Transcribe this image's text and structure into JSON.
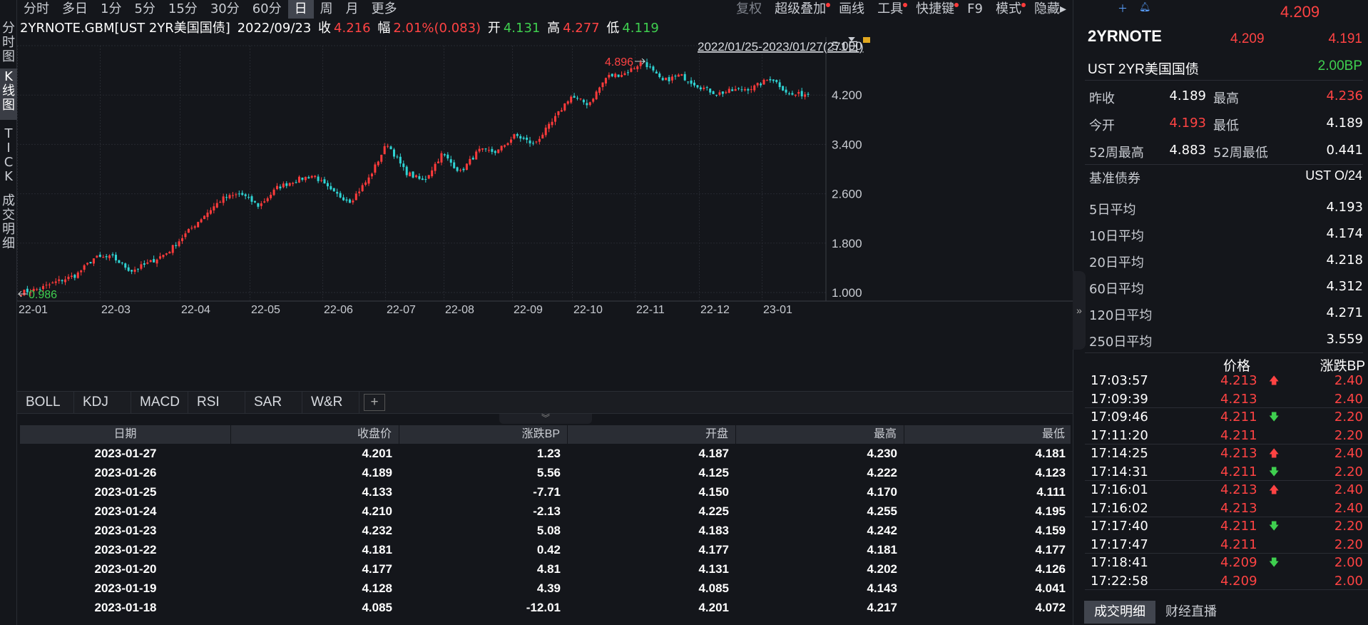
{
  "side_tabs": [
    {
      "label": "分时图",
      "active": false
    },
    {
      "label": "K线图",
      "active": true
    },
    {
      "label": "TICK",
      "active": false
    },
    {
      "label": "成交明细",
      "active": false
    }
  ],
  "toolbar": {
    "periods": [
      "分时",
      "多日",
      "1分",
      "5分",
      "15分",
      "30分",
      "60分",
      "日",
      "周",
      "月",
      "更多"
    ],
    "active_period": "日",
    "right_items": [
      {
        "label": "复权",
        "dim": true,
        "dot": false
      },
      {
        "label": "超级叠加",
        "dim": false,
        "dot": true
      },
      {
        "label": "画线",
        "dim": false,
        "dot": false
      },
      {
        "label": "工具",
        "dim": false,
        "dot": true
      },
      {
        "label": "快捷键",
        "dim": false,
        "dot": true
      },
      {
        "label": "F9",
        "dim": false,
        "dot": false
      },
      {
        "label": "模式",
        "dim": false,
        "dot": true
      },
      {
        "label": "隐藏▸",
        "dim": false,
        "dot": false
      }
    ]
  },
  "info": {
    "symbol": "2YRNOTE.GBM[UST 2YR美国国债]",
    "date": "2022/09/23",
    "close_label": "收",
    "close": "4.216",
    "change_label": "幅",
    "change": "2.01%(0.083)",
    "open_label": "开",
    "open": "4.131",
    "high_label": "高",
    "high": "4.277",
    "low_label": "低",
    "low": "4.119"
  },
  "chart_data": {
    "type": "candlestick",
    "range_label": "2022/01/25-2023/01/27(271日)",
    "ylim": [
      1.0,
      5.0
    ],
    "yticks": [
      "5.000",
      "4.200",
      "3.400",
      "2.600",
      "1.800",
      "1.000"
    ],
    "xticks": [
      "22-01",
      "22-03",
      "22-04",
      "22-05",
      "22-06",
      "22-07",
      "22-08",
      "22-09",
      "22-10",
      "22-11",
      "22-12",
      "23-01"
    ],
    "max_label": "4.896",
    "min_label": "0.986",
    "colors": {
      "up": "#ff3b3b",
      "down": "#2fd4d4",
      "grid": "#262930"
    },
    "closes": [
      1.0,
      1.06,
      1.18,
      1.28,
      1.56,
      1.57,
      1.35,
      1.48,
      1.65,
      1.95,
      2.25,
      2.52,
      2.6,
      2.4,
      2.7,
      2.82,
      2.9,
      2.62,
      2.48,
      2.85,
      3.42,
      2.95,
      2.8,
      3.25,
      2.95,
      3.3,
      3.28,
      3.55,
      3.4,
      3.75,
      4.18,
      4.05,
      4.5,
      4.55,
      4.75,
      4.42,
      4.52,
      4.35,
      4.22,
      4.28,
      4.32,
      4.48,
      4.2,
      4.22
    ]
  },
  "indicators": [
    "BOLL",
    "KDJ",
    "MACD",
    "RSI",
    "SAR",
    "W&R"
  ],
  "table": {
    "headers": [
      "日期",
      "收盘价",
      "涨跌BP",
      "开盘",
      "最高",
      "最低"
    ],
    "rows": [
      [
        "2023-01-27",
        "4.201",
        "1.23",
        "4.187",
        "4.230",
        "4.181"
      ],
      [
        "2023-01-26",
        "4.189",
        "5.56",
        "4.125",
        "4.222",
        "4.123"
      ],
      [
        "2023-01-25",
        "4.133",
        "-7.71",
        "4.150",
        "4.170",
        "4.111"
      ],
      [
        "2023-01-24",
        "4.210",
        "-2.13",
        "4.225",
        "4.255",
        "4.195"
      ],
      [
        "2023-01-23",
        "4.232",
        "5.08",
        "4.183",
        "4.242",
        "4.159"
      ],
      [
        "2023-01-22",
        "4.181",
        "0.42",
        "4.177",
        "4.181",
        "4.177"
      ],
      [
        "2023-01-20",
        "4.177",
        "4.81",
        "4.131",
        "4.202",
        "4.126"
      ],
      [
        "2023-01-19",
        "4.128",
        "4.39",
        "4.085",
        "4.143",
        "4.041"
      ],
      [
        "2023-01-18",
        "4.085",
        "-12.01",
        "4.201",
        "4.217",
        "4.072"
      ]
    ]
  },
  "quote": {
    "top_price": "4.209",
    "name": "2YRNOTE",
    "bid": "4.209",
    "ask": "4.191",
    "full_name": "UST 2YR美国国债",
    "change_bp": "2.00BP",
    "stats": [
      {
        "l1": "昨收",
        "v1": "4.189",
        "c1": "white",
        "l2": "最高",
        "v2": "4.236",
        "c2": "red"
      },
      {
        "l1": "今开",
        "v1": "4.193",
        "c1": "red",
        "l2": "最低",
        "v2": "4.189",
        "c2": "white"
      },
      {
        "l1": "52周最高",
        "v1": "4.883",
        "c1": "white",
        "l2": "52周最低",
        "v2": "0.441",
        "c2": "white"
      }
    ],
    "benchmark_label": "基准债券",
    "benchmark_value": "UST O/24",
    "averages": [
      {
        "label": "5日平均",
        "value": "4.193"
      },
      {
        "label": "10日平均",
        "value": "4.174"
      },
      {
        "label": "20日平均",
        "value": "4.218"
      },
      {
        "label": "60日平均",
        "value": "4.312"
      },
      {
        "label": "120日平均",
        "value": "4.271"
      },
      {
        "label": "250日平均",
        "value": "3.559"
      }
    ],
    "ticks_header": {
      "price": "价格",
      "change": "涨跌BP"
    },
    "ticks": [
      {
        "time": "17:03:57",
        "price": "4.213",
        "dir": "up",
        "bp": "2.40"
      },
      {
        "time": "17:09:39",
        "price": "4.213",
        "dir": "",
        "bp": "2.40"
      },
      {
        "time": "17:09:46",
        "price": "4.211",
        "dir": "down",
        "bp": "2.20"
      },
      {
        "time": "17:11:20",
        "price": "4.211",
        "dir": "",
        "bp": "2.20"
      },
      {
        "time": "17:14:25",
        "price": "4.213",
        "dir": "up",
        "bp": "2.40"
      },
      {
        "time": "17:14:31",
        "price": "4.211",
        "dir": "down",
        "bp": "2.20"
      },
      {
        "time": "17:16:01",
        "price": "4.213",
        "dir": "up",
        "bp": "2.40"
      },
      {
        "time": "17:16:02",
        "price": "4.213",
        "dir": "",
        "bp": "2.40"
      },
      {
        "time": "17:17:40",
        "price": "4.211",
        "dir": "down",
        "bp": "2.20"
      },
      {
        "time": "17:17:47",
        "price": "4.211",
        "dir": "",
        "bp": "2.20"
      },
      {
        "time": "17:18:41",
        "price": "4.209",
        "dir": "down",
        "bp": "2.00"
      },
      {
        "time": "17:22:58",
        "price": "4.209",
        "dir": "",
        "bp": "2.00"
      }
    ],
    "bottom_tabs": [
      {
        "label": "成交明细",
        "active": true
      },
      {
        "label": "财经直播",
        "active": false
      }
    ]
  }
}
